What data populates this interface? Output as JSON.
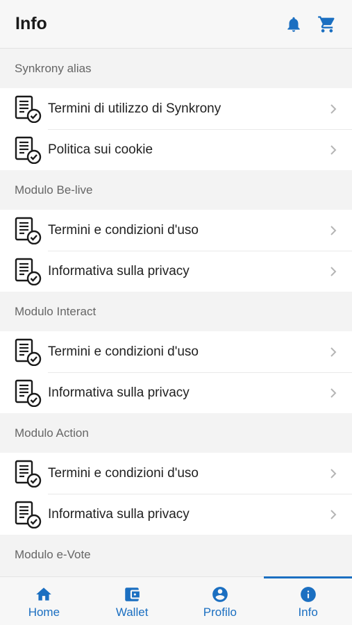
{
  "header": {
    "title": "Info",
    "bell_icon": "bell-icon",
    "cart_icon": "cart-icon",
    "accent": "#1b6fc1"
  },
  "sections": [
    {
      "title": "Synkrony alias",
      "items": [
        {
          "label": "Termini di utilizzo di Synkrony"
        },
        {
          "label": "Politica sui cookie"
        }
      ]
    },
    {
      "title": "Modulo Be-live",
      "items": [
        {
          "label": "Termini e condizioni d'uso"
        },
        {
          "label": "Informativa sulla privacy"
        }
      ]
    },
    {
      "title": "Modulo Interact",
      "items": [
        {
          "label": "Termini e condizioni d'uso"
        },
        {
          "label": "Informativa sulla privacy"
        }
      ]
    },
    {
      "title": "Modulo Action",
      "items": [
        {
          "label": "Termini e condizioni d'uso"
        },
        {
          "label": "Informativa sulla privacy"
        }
      ]
    },
    {
      "title": "Modulo e-Vote",
      "items": []
    }
  ],
  "bottom_nav": [
    {
      "label": "Home",
      "icon": "home-icon"
    },
    {
      "label": "Wallet",
      "icon": "wallet-icon"
    },
    {
      "label": "Profilo",
      "icon": "account-icon"
    },
    {
      "label": "Info",
      "icon": "info-icon",
      "active": true
    }
  ]
}
